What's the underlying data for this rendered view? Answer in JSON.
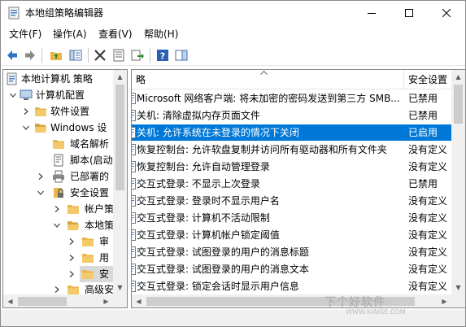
{
  "window": {
    "title": "本地组策略编辑器"
  },
  "menu": [
    {
      "label": "文件(F)"
    },
    {
      "label": "操作(A)"
    },
    {
      "label": "查看(V)"
    },
    {
      "label": "帮助(H)"
    }
  ],
  "toolbar": {
    "buttons": [
      "back-arrow-icon",
      "forward-arrow-icon",
      "up-folder-icon",
      "show-tree-icon",
      "delete-icon",
      "properties-icon",
      "export-icon",
      "help-icon",
      "show-panel-icon"
    ]
  },
  "tree": {
    "items": [
      {
        "label": "本地计算机 策略"
      },
      {
        "label": "计算机配置"
      },
      {
        "label": "软件设置"
      },
      {
        "label": "Windows 设"
      },
      {
        "label": "域名解析"
      },
      {
        "label": "脚本(启动"
      },
      {
        "label": "已部署的"
      },
      {
        "label": "安全设置"
      },
      {
        "label": "帐户策"
      },
      {
        "label": "本地策"
      },
      {
        "label": "审"
      },
      {
        "label": "用"
      },
      {
        "label": "安"
      },
      {
        "label": "高级安"
      }
    ]
  },
  "list": {
    "columns": {
      "name": "略",
      "setting": "安全设置"
    },
    "rows": [
      {
        "name": "Microsoft 网络客户端: 将未加密的密码发送到第三方 SMB...",
        "value": "已禁用"
      },
      {
        "name": "关机: 清除虚拟内存页面文件",
        "value": "已禁用"
      },
      {
        "name": "关机: 允许系统在未登录的情况下关闭",
        "value": "已启用"
      },
      {
        "name": "恢复控制台: 允许软盘复制并访问所有驱动器和所有文件夹",
        "value": "没有定义"
      },
      {
        "name": "恢复控制台: 允许自动管理登录",
        "value": "没有定义"
      },
      {
        "name": "交互式登录: 不显示上次登录",
        "value": "已禁用"
      },
      {
        "name": "交互式登录: 登录时不显示用户名",
        "value": "没有定义"
      },
      {
        "name": "交互式登录: 计算机不活动限制",
        "value": "没有定义"
      },
      {
        "name": "交互式登录: 计算机帐户锁定阈值",
        "value": "没有定义"
      },
      {
        "name": "交互式登录: 试图登录的用户的消息标题",
        "value": "没有定义"
      },
      {
        "name": "交互式登录: 试图登录的用户的消息文本",
        "value": "没有定义"
      },
      {
        "name": "交互式登录: 锁定会话时显示用户信息",
        "value": "没有定义"
      }
    ]
  },
  "watermark": {
    "text": "下个好软件",
    "url": "WWW.XIAIGE.COM"
  },
  "colors": {
    "selection": "#0078d7",
    "folder": "#e8b64a",
    "nav_arrow": "#2a73c5"
  }
}
